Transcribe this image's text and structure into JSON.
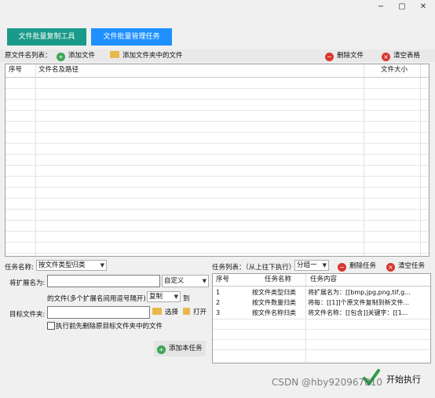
{
  "window": {
    "minimize": "−",
    "maximize": "▢",
    "close": "✕"
  },
  "tabs": [
    {
      "label": "文件批量复制工具",
      "color": "#1a9a8a"
    },
    {
      "label": "文件批量管理任务",
      "color": "#1e90ff"
    }
  ],
  "toolbar": {
    "list_label": "原文件名列表：",
    "add_file": "添加文件",
    "add_folder_files": "添加文件夹中的文件",
    "delete_file": "删除文件",
    "clear_table": "清空表格"
  },
  "file_table": {
    "headers": {
      "index": "序号",
      "path": "文件名及路径",
      "size": "文件大小"
    }
  },
  "task_form": {
    "task_name_label": "任务名称:",
    "task_name_value": "按文件类型归类",
    "ext_label": "将扩展名为:",
    "ext_value": "",
    "ext_mode": "自定义",
    "files_desc": "的文件(多个扩展名间用逗号隔开)",
    "action": "复制",
    "to": "到",
    "target_label": "目标文件夹:",
    "target_value": "",
    "choose": "选择",
    "open": "打开",
    "pre_delete_checkbox": "执行前先删除原目标文件夹中的文件",
    "add_task": "添加本任务"
  },
  "task_list": {
    "label": "任务列表：（从上往下执行）",
    "group": "分组一",
    "delete_task": "删除任务",
    "clear_task": "清空任务",
    "headers": {
      "index": "序号",
      "name": "任务名称",
      "content": "任务内容"
    },
    "rows": [
      {
        "index": "1",
        "name": "按文件类型归类",
        "content": "将扩展名为：[[bmp,jpg,png,tif,g..."
      },
      {
        "index": "2",
        "name": "按文件数量归类",
        "content": "将每：[[1]]个原文件复制到新文件..."
      },
      {
        "index": "3",
        "name": "按文件名称归类",
        "content": "将文件名称：[[包含]]关键字：[[1..."
      }
    ]
  },
  "start_button": "开始执行",
  "watermark": "CSDN @hby920967810"
}
